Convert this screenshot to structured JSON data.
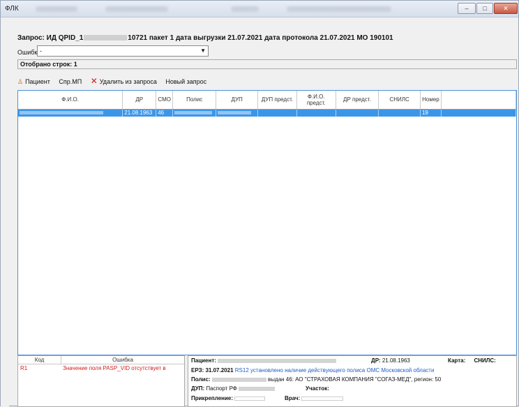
{
  "window": {
    "title": "ФЛК",
    "controls": [
      "–",
      "□",
      "✕"
    ]
  },
  "request": {
    "label": "Запрос:",
    "id_prefix": "ИД QPID_1",
    "id_suffix": "10721",
    "rest": "пакет 1 дата выгрузки 21.07.2021 дата протокола 21.07.2021 МО 190101"
  },
  "filter": {
    "label": "Ошибки",
    "value": "-"
  },
  "rows_shown": "Отобрано строк: 1",
  "toolbar": {
    "patient": "Пациент",
    "spr_mp": "Спр.МП",
    "remove": "Удалить из запроса",
    "new_request": "Новый запрос"
  },
  "grid": {
    "columns": [
      "Ф.И.О.",
      "ДР",
      "СМО",
      "Полис",
      "ДУП",
      "ДУП предст.",
      "Ф.И.О. предст.",
      "ДР предст.",
      "СНИЛС",
      "Номер"
    ],
    "row": {
      "dr": "21.08.1963",
      "smo": "46",
      "num": "19"
    }
  },
  "errors_table": {
    "headers": [
      "Код",
      "Ошибка"
    ],
    "row": {
      "code": "R1",
      "message": "Значение поля PASP_VID отсутствует в"
    }
  },
  "details": {
    "patient_label": "Пациент:",
    "dr_label": "ДР:",
    "dr_value": "21.08.1963",
    "card_label": "Карта:",
    "snils_label": "СНИЛС:",
    "erz_label": "ЕРЗ:",
    "erz_date": "31.07.2021",
    "erz_text": "RS12 установлено наличие действующего полиса ОМС Московской области",
    "policy_label": "Полис:",
    "policy_text": "выдан 46: АО \"СТРАХОВАЯ КОМПАНИЯ \"СОГАЗ-МЕД\", регион: 50",
    "dup_label": "ДУП:",
    "dup_text": "Паспорт РФ",
    "area_label": "Участок:",
    "attach_label": "Прикрепление:",
    "doctor_label": "Врач:"
  }
}
